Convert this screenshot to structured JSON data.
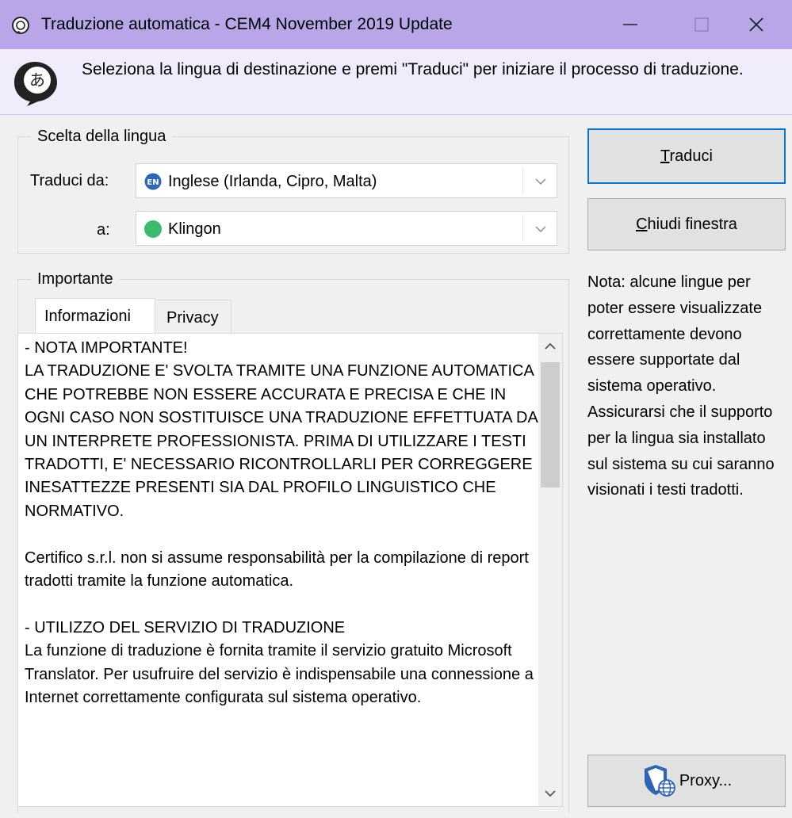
{
  "window": {
    "title": "Traduzione automatica - CEM4 November 2019 Update",
    "minimize_glyph": "—",
    "maximize_glyph": "☐",
    "close_glyph": "✕"
  },
  "banner": {
    "icon": "translate-speech-bubble-icon",
    "text": "Seleziona la lingua di destinazione e premi \"Traduci\" per iniziare il processo di traduzione."
  },
  "language_group": {
    "legend": "Scelta della lingua",
    "from_label": "Traduci da:",
    "from_value": "Inglese (Irlanda, Cipro, Malta)",
    "from_badge": "EN",
    "to_label": "a:",
    "to_value": "Klingon",
    "to_color": "#3cba6d"
  },
  "buttons": {
    "translate": "Traduci",
    "translate_accel": "T",
    "translate_rest": "raduci",
    "close_accel": "C",
    "close_rest": "hiudi finestra",
    "proxy": "Proxy..."
  },
  "note": "Nota: alcune lingue per poter essere visualizzate correttamente devono essere supportate dal sistema operativo. Assicurarsi che il supporto per la lingua sia installato sul sistema su cui saranno visionati i testi tradotti.",
  "important_group": {
    "legend": "Importante",
    "tabs": [
      {
        "label": "Informazioni",
        "active": true
      },
      {
        "label": "Privacy",
        "active": false
      }
    ],
    "content": "- NOTA IMPORTANTE!\nLA TRADUZIONE E' SVOLTA TRAMITE UNA FUNZIONE AUTOMATICA CHE POTREBBE NON ESSERE ACCURATA E PRECISA E CHE IN OGNI CASO NON SOSTITUISCE UNA TRADUZIONE EFFETTUATA DA UN INTERPRETE PROFESSIONISTA. PRIMA DI UTILIZZARE I TESTI TRADOTTI, E' NECESSARIO RICONTROLLARLI PER CORREGGERE INESATTEZZE PRESENTI SIA DAL PROFILO LINGUISTICO CHE NORMATIVO.\n\nCertifico s.r.l. non si assume responsabilità per la compilazione di report tradotti tramite la funzione automatica.\n\n- UTILIZZO DEL SERVIZIO DI TRADUZIONE\nLa funzione di traduzione è fornita tramite il servizio gratuito Microsoft Translator. Per usufruire del servizio è indispensabile una connessione a Internet correttamente configurata sul sistema operativo."
  },
  "colors": {
    "titlebar": "#b8a6e8",
    "banner": "#f1ecfb",
    "accent": "#0078d7"
  }
}
